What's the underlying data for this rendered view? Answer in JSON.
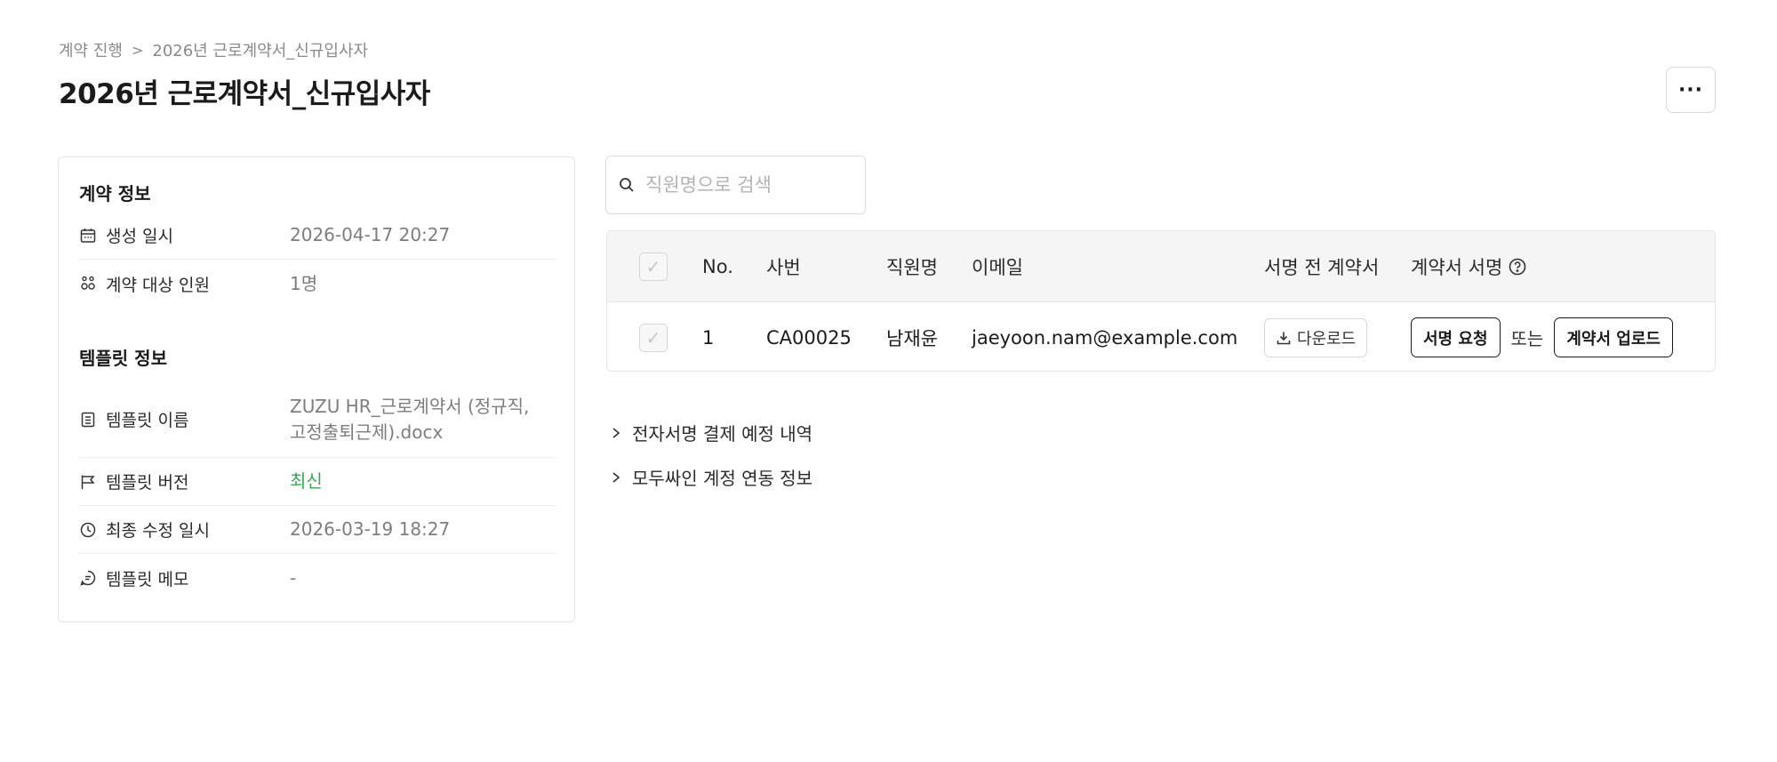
{
  "breadcrumb": {
    "parent": "계약 진행",
    "separator": ">",
    "current": "2026년 근로계약서_신규입사자"
  },
  "page_title": "2026년 근로계약서_신규입사자",
  "more_button": "···",
  "contract_info": {
    "title": "계약 정보",
    "created_label": "생성 일시",
    "created_value": "2026-04-17 20:27",
    "targets_label": "계약 대상 인원",
    "targets_value": "1명"
  },
  "template_info": {
    "title": "템플릿 정보",
    "name_label": "템플릿 이름",
    "name_value_line1": "ZUZU HR_근로계약서 (정규직,",
    "name_value_line2": "고정출퇴근제).docx",
    "version_label": "템플릿 버전",
    "version_value": "최신",
    "version_color": "#3aa655",
    "modified_label": "최종 수정 일시",
    "modified_value": "2026-03-19 18:27",
    "memo_label": "템플릿 메모",
    "memo_value": "-"
  },
  "search": {
    "placeholder": "직원명으로 검색"
  },
  "table": {
    "headers": {
      "no": "No.",
      "emp_id": "사번",
      "name": "직원명",
      "email": "이메일",
      "pre_sign": "서명 전 계약서",
      "sign": "계약서 서명"
    },
    "rows": [
      {
        "no": "1",
        "emp_id": "CA00025",
        "name": "남재윤",
        "email": "jaeyoon.nam@example.com",
        "download_label": "다운로드",
        "request_label": "서명 요청",
        "or_label": "또는",
        "upload_label": "계약서 업로드"
      }
    ]
  },
  "expanders": {
    "payment": "전자서명 결제 예정 내역",
    "modusign": "모두싸인 계정 연동 정보"
  }
}
